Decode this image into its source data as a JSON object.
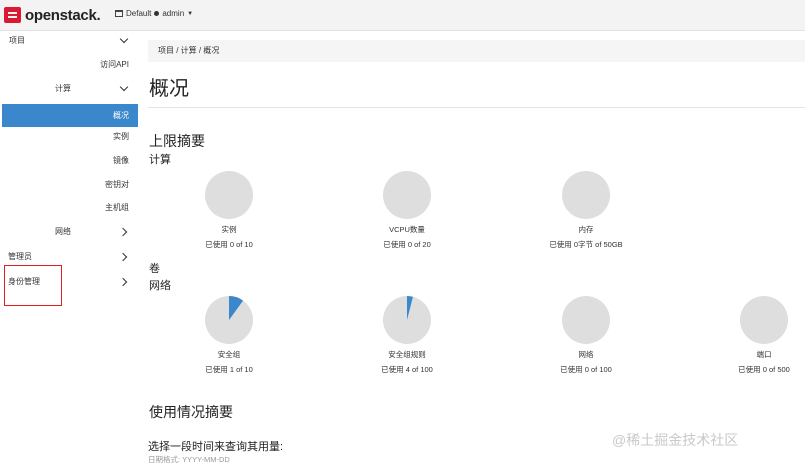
{
  "header": {
    "brand": "openstack.",
    "project_selector": "Default",
    "user": "admin"
  },
  "sidebar": {
    "items": [
      {
        "label": "项目",
        "level": 0,
        "state": "expanded"
      },
      {
        "label": "访问API",
        "level": 2
      },
      {
        "label": "计算",
        "level": 1,
        "state": "expanded"
      },
      {
        "label": "概况",
        "level": 2,
        "active": true
      },
      {
        "label": "实例",
        "level": 2
      },
      {
        "label": "镜像",
        "level": 2
      },
      {
        "label": "密钥对",
        "level": 2
      },
      {
        "label": "主机组",
        "level": 2
      },
      {
        "label": "网络",
        "level": 1,
        "state": "collapsed"
      },
      {
        "label": "管理员",
        "level": 0,
        "state": "collapsed"
      },
      {
        "label": "身份管理",
        "level": 0,
        "state": "collapsed",
        "highlighted": true
      }
    ]
  },
  "breadcrumb": {
    "text": "项目 / 计算 / 概况"
  },
  "page": {
    "title": "概况",
    "limits_title": "上限摘要",
    "compute_group": "计算",
    "volume_group": "卷",
    "network_group": "网络",
    "usage_title": "使用情况摘要",
    "usage_prompt": "选择一段时间来查询其用量:",
    "date_format": "日期格式: YYYY-MM-DD"
  },
  "limits": {
    "compute": [
      {
        "label": "实例",
        "usage": "已使用 0 of 10",
        "used": 0,
        "total": 10
      },
      {
        "label": "VCPU数量",
        "usage": "已使用 0 of 20",
        "used": 0,
        "total": 20
      },
      {
        "label": "内存",
        "usage": "已使用 0字节 of 50GB",
        "used": 0,
        "total": 50
      }
    ],
    "network": [
      {
        "label": "安全组",
        "usage": "已使用 1 of 10",
        "used": 1,
        "total": 10
      },
      {
        "label": "安全组规则",
        "usage": "已使用 4 of 100",
        "used": 4,
        "total": 100
      },
      {
        "label": "网络",
        "usage": "已使用 0 of 100",
        "used": 0,
        "total": 100
      },
      {
        "label": "端口",
        "usage": "已使用 0 of 500",
        "used": 0,
        "total": 500
      }
    ]
  },
  "colors": {
    "pie_empty": "#dedede",
    "pie_used": "#3a87cb",
    "active_nav": "#3a87cb",
    "highlight": "#e02020"
  },
  "watermark": "@稀土掘金技术社区"
}
